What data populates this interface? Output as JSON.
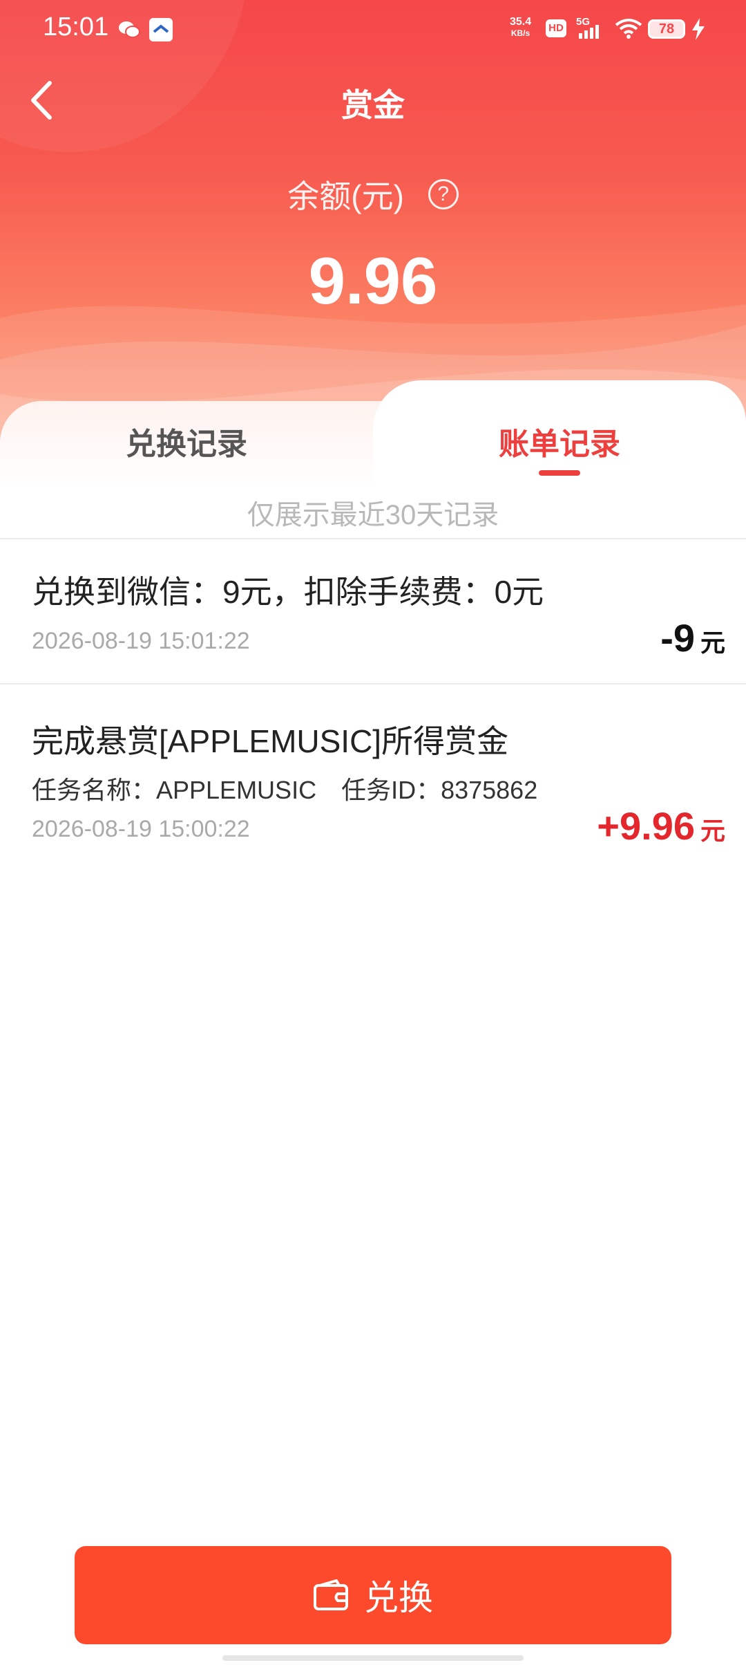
{
  "status_bar": {
    "time": "15:01",
    "net_speed_value": "35.4",
    "net_speed_unit": "KB/s",
    "hd": "HD",
    "network": "5G",
    "battery": "78"
  },
  "nav": {
    "title": "赏金"
  },
  "balance": {
    "label": "余额(元)",
    "help": "?",
    "value": "9.96"
  },
  "tabs": [
    {
      "label": "兑换记录",
      "active": false
    },
    {
      "label": "账单记录",
      "active": true
    }
  ],
  "notice": "仅展示最近30天记录",
  "records": [
    {
      "title": "兑换到微信：9元，扣除手续费：0元",
      "time": "2026-08-19 15:01:22",
      "amount": "-9",
      "unit": "元"
    },
    {
      "title": "完成悬赏[APPLEMUSIC]所得赏金",
      "detail": "任务名称：APPLEMUSIC　任务ID：8375862",
      "time": "2026-08-19 15:00:22",
      "amount": "+9.96",
      "unit": "元"
    }
  ],
  "button": {
    "label": "兑换",
    "icon": "wallet-icon"
  },
  "colors": {
    "header_red": "#f5474a",
    "accent_red": "#ee3f3f",
    "positive_amount": "#e3272c",
    "button": "#fd4a2c"
  }
}
